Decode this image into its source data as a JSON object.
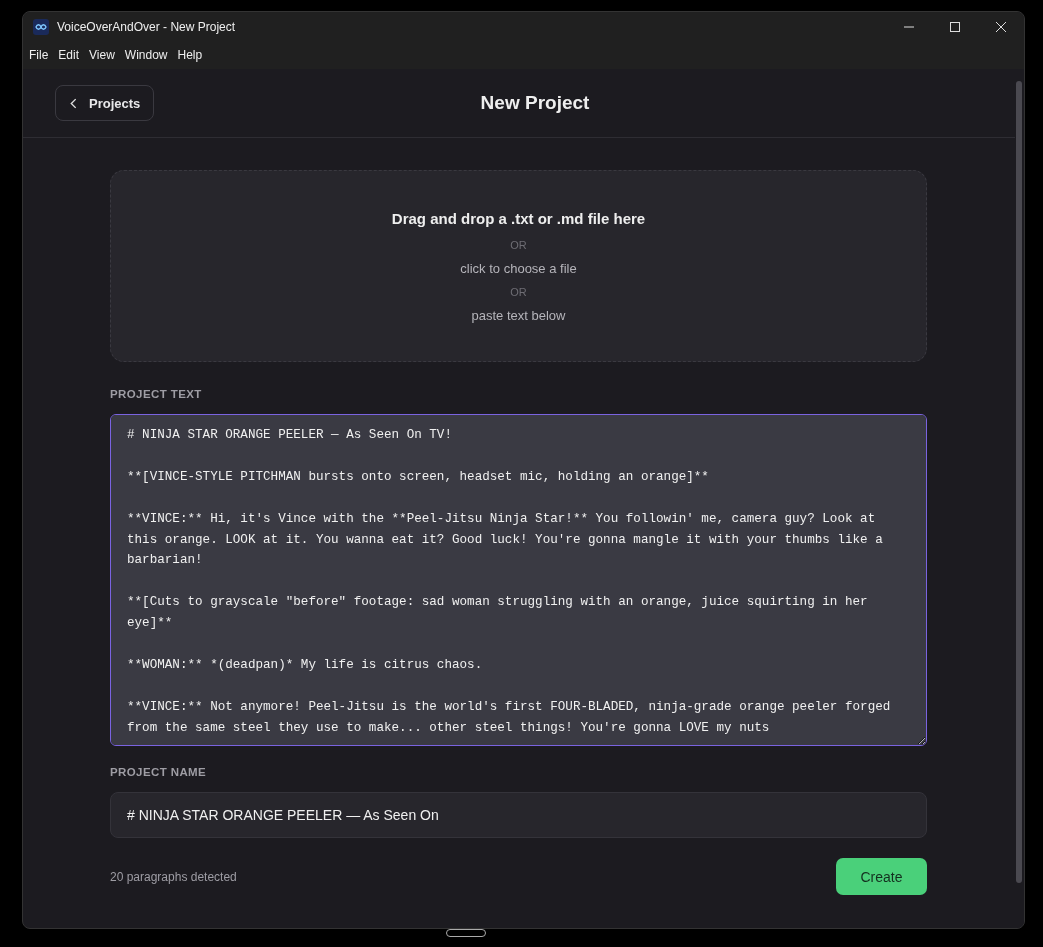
{
  "window": {
    "title": "VoiceOverAndOver - New Project"
  },
  "menu": [
    "File",
    "Edit",
    "View",
    "Window",
    "Help"
  ],
  "header": {
    "back_button": "Projects",
    "title": "New Project"
  },
  "drop_zone": {
    "heading": "Drag and drop a .txt or .md file here",
    "lines": [
      {
        "kind": "divider",
        "text": "OR"
      },
      {
        "kind": "action",
        "text": "click to choose a file"
      },
      {
        "kind": "divider",
        "text": "OR"
      },
      {
        "kind": "action",
        "text": "paste text below"
      }
    ]
  },
  "project_text": {
    "label": "PROJECT TEXT",
    "value": "# NINJA STAR ORANGE PEELER — As Seen On TV!\n\n**[VINCE-STYLE PITCHMAN bursts onto screen, headset mic, holding an orange]**\n\n**VINCE:** Hi, it's Vince with the **Peel-Jitsu Ninja Star!** You followin' me, camera guy? Look at this orange. LOOK at it. You wanna eat it? Good luck! You're gonna mangle it with your thumbs like a barbarian!\n\n**[Cuts to grayscale \"before\" footage: sad woman struggling with an orange, juice squirting in her eye]**\n\n**WOMAN:** *(deadpan)* My life is citrus chaos.\n\n**VINCE:** Not anymore! Peel-Jitsu is the world's first FOUR-BLADED, ninja-grade orange peeler forged from the same steel they use to make... other steel things! You're gonna LOVE my nuts"
  },
  "project_name": {
    "label": "PROJECT NAME",
    "value": "# NINJA STAR ORANGE PEELER — As Seen On"
  },
  "footer": {
    "status": "20 paragraphs detected",
    "create_button": "Create"
  }
}
